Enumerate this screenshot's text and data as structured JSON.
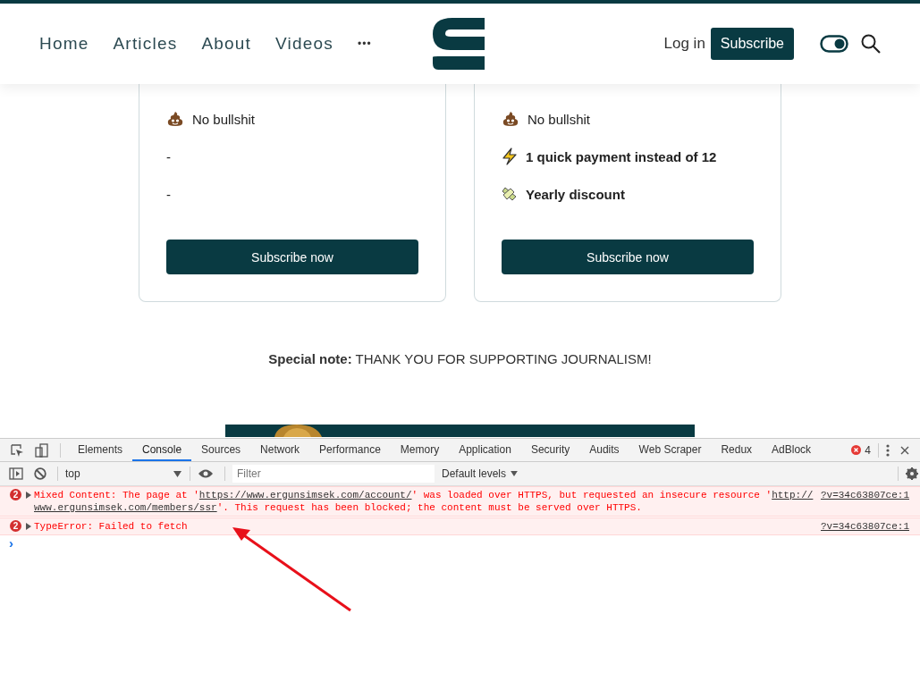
{
  "nav": {
    "items": [
      "Home",
      "Articles",
      "About",
      "Videos"
    ],
    "more": "•••",
    "login": "Log in",
    "subscribe": "Subscribe",
    "theme_toggle": {
      "on": true
    }
  },
  "cards": [
    {
      "features": [
        {
          "kind": "poop",
          "text": "No bullshit",
          "bold": false
        },
        {
          "kind": "plain",
          "text": "-",
          "bold": false
        },
        {
          "kind": "plain",
          "text": "-",
          "bold": false
        }
      ],
      "button": "Subscribe now"
    },
    {
      "features": [
        {
          "kind": "poop",
          "text": "No bullshit",
          "bold": false
        },
        {
          "kind": "bolt",
          "text": "1 quick payment instead of 12",
          "bold": true
        },
        {
          "kind": "money",
          "text": "Yearly discount",
          "bold": true
        }
      ],
      "button": "Subscribe now"
    }
  ],
  "special_note": "**Special note:** THANK YOU FOR SUPPORTING JOURNALISM!",
  "devtools": {
    "tabs": [
      {
        "label": "Elements",
        "selected": false
      },
      {
        "label": "Console",
        "selected": true
      },
      {
        "label": "Sources",
        "selected": false
      },
      {
        "label": "Network",
        "selected": false
      },
      {
        "label": "Performance",
        "selected": false
      },
      {
        "label": "Memory",
        "selected": false
      },
      {
        "label": "Application",
        "selected": false
      },
      {
        "label": "Security",
        "selected": false
      },
      {
        "label": "Audits",
        "selected": false
      },
      {
        "label": "Web Scraper",
        "selected": false
      },
      {
        "label": "Redux",
        "selected": false
      },
      {
        "label": "AdBlock",
        "selected": false
      }
    ],
    "error_count": "4",
    "context": "top",
    "filter": {
      "placeholder": "Filter"
    },
    "levels": "Default levels",
    "messages": [
      {
        "count": "2",
        "lines": [
          [
            {
              "text": "Mixed Content: The page at '",
              "link": false
            },
            {
              "text": "https://www.ergunsimsek.com/account/",
              "link": true
            },
            {
              "text": "' was loaded over HTTPS, but requested an insecure resource '",
              "link": false
            },
            {
              "text": "http://",
              "link": true
            }
          ],
          [
            {
              "text": "www.ergunsimsek.com/members/ssr",
              "link": true
            },
            {
              "text": "'. This request has been blocked; the content must be served over HTTPS.",
              "link": false
            }
          ]
        ],
        "source": "?v=34c63807ce:1"
      },
      {
        "count": "2",
        "lines": [
          [
            {
              "text": "TypeError: Failed to fetch",
              "link": false
            }
          ]
        ],
        "source": "?v=34c63807ce:1"
      }
    ],
    "prompt": "›"
  }
}
